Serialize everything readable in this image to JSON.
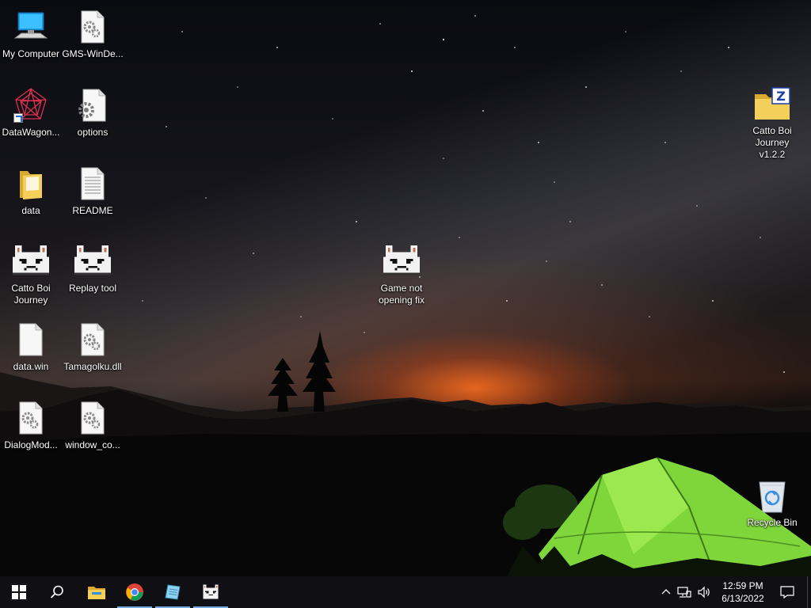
{
  "desktop": {
    "icons": [
      {
        "label": "My Computer"
      },
      {
        "label": "GMS-WinDe..."
      },
      {
        "label": "DataWagon..."
      },
      {
        "label": "options"
      },
      {
        "label": "data"
      },
      {
        "label": "README"
      },
      {
        "label": "Catto Boi Journey"
      },
      {
        "label": "Replay tool"
      },
      {
        "label": "data.win"
      },
      {
        "label": "Tamagolku.dll"
      },
      {
        "label": "DialogMod..."
      },
      {
        "label": "window_co..."
      },
      {
        "label": "Game not opening fix"
      },
      {
        "label": "Catto Boi Journey v1.2.2"
      },
      {
        "label": "Recycle Bin"
      }
    ]
  },
  "taskbar": {
    "buttons": [
      {
        "icon": "windows-start-icon"
      },
      {
        "icon": "search-icon"
      },
      {
        "icon": "file-explorer-icon"
      },
      {
        "icon": "chrome-icon"
      },
      {
        "icon": "notepad-icon"
      },
      {
        "icon": "catto-boi-app-icon"
      }
    ],
    "clock": {
      "time": "12:59 PM",
      "date": "6/13/2022"
    }
  },
  "colors": {
    "taskbar": "#101014",
    "accent": "#76a9e0",
    "tent": "#7fd63a"
  }
}
